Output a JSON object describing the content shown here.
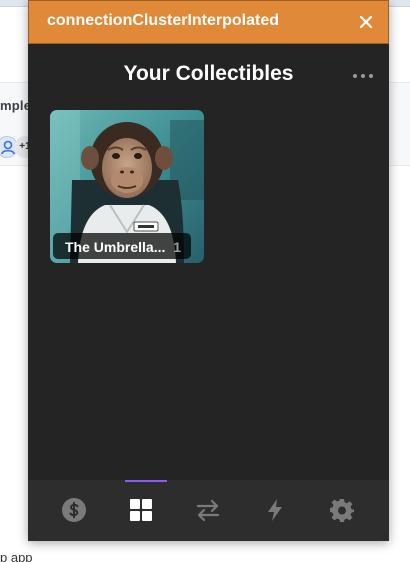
{
  "background_page": {
    "fragment_text": "mple",
    "avatar_more_count": "+1",
    "bottom_fragment": "p app"
  },
  "popup": {
    "title": "connectionClusterInterpolated",
    "accent_color": "#e08a39",
    "header_title": "Your Collectibles",
    "collectibles": [
      {
        "name": "The Umbrella...",
        "count": "1",
        "image": "chimpanzee-in-white-uniform"
      }
    ],
    "tabs": [
      {
        "name": "tokens",
        "icon": "dollar-icon",
        "active": false
      },
      {
        "name": "collectibles",
        "icon": "grid-icon",
        "active": true
      },
      {
        "name": "swap",
        "icon": "swap-arrows-icon",
        "active": false
      },
      {
        "name": "activity",
        "icon": "lightning-icon",
        "active": false
      },
      {
        "name": "settings",
        "icon": "gear-icon",
        "active": false
      }
    ],
    "active_tab_color": "#8a5cf5"
  }
}
